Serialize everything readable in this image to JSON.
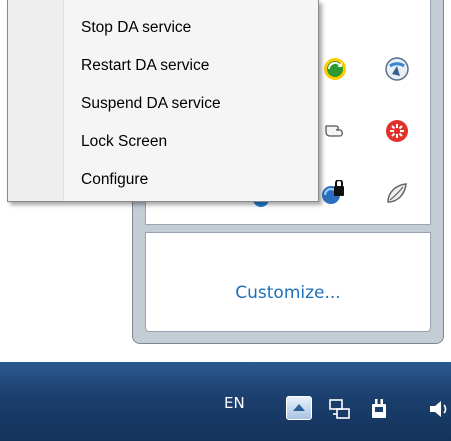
{
  "context_menu": {
    "items": [
      {
        "label": "Stop DA service"
      },
      {
        "label": "Restart DA service"
      },
      {
        "label": "Suspend DA service"
      },
      {
        "label": "Lock Screen"
      },
      {
        "label": "Configure"
      }
    ]
  },
  "tray_flyout": {
    "customize_label": "Customize...",
    "icons": [
      "green-refresh-icon",
      "network-globe-icon",
      "hand-icon",
      "red-burst-icon",
      "lock-network-icon",
      "leaf-icon",
      "drive-icon",
      "blue-dot-icon"
    ]
  },
  "taskbar": {
    "language": "EN",
    "icons": [
      "show-hidden-icons-button",
      "network-icon",
      "power-icon",
      "speaker-icon"
    ]
  }
}
